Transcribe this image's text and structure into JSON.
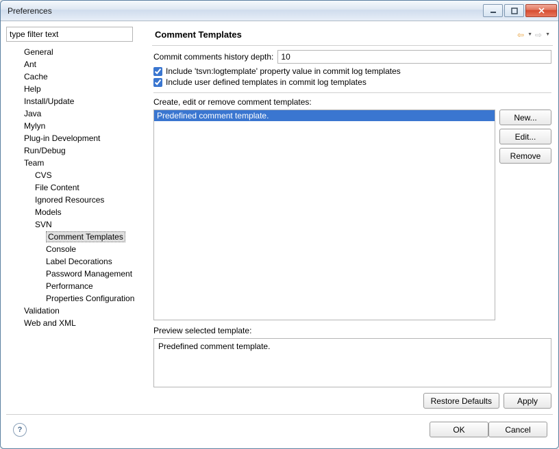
{
  "window": {
    "title": "Preferences"
  },
  "filter": {
    "value": "type filter text"
  },
  "tree": [
    {
      "label": "General",
      "indent": 1
    },
    {
      "label": "Ant",
      "indent": 1
    },
    {
      "label": "Cache",
      "indent": 1
    },
    {
      "label": "Help",
      "indent": 1
    },
    {
      "label": "Install/Update",
      "indent": 1
    },
    {
      "label": "Java",
      "indent": 1
    },
    {
      "label": "Mylyn",
      "indent": 1
    },
    {
      "label": "Plug-in Development",
      "indent": 1
    },
    {
      "label": "Run/Debug",
      "indent": 1
    },
    {
      "label": "Team",
      "indent": 1
    },
    {
      "label": "CVS",
      "indent": 2
    },
    {
      "label": "File Content",
      "indent": 2
    },
    {
      "label": "Ignored Resources",
      "indent": 2
    },
    {
      "label": "Models",
      "indent": 2
    },
    {
      "label": "SVN",
      "indent": 2
    },
    {
      "label": "Comment Templates",
      "indent": 3,
      "selected": true
    },
    {
      "label": "Console",
      "indent": 3
    },
    {
      "label": "Label Decorations",
      "indent": 3
    },
    {
      "label": "Password Management",
      "indent": 3
    },
    {
      "label": "Performance",
      "indent": 3
    },
    {
      "label": "Properties Configuration",
      "indent": 3
    },
    {
      "label": "Validation",
      "indent": 1
    },
    {
      "label": "Web and XML",
      "indent": 1
    }
  ],
  "page": {
    "title": "Comment Templates",
    "history_label": "Commit comments history depth:",
    "history_value": "10",
    "chk_tsvn": "Include 'tsvn:logtemplate' property value in commit log templates",
    "chk_user": "Include user defined templates in commit log templates",
    "templates_label": "Create, edit or remove comment templates:",
    "templates": [
      {
        "text": "Predefined comment template.",
        "selected": true
      }
    ],
    "btn_new": "New...",
    "btn_edit": "Edit...",
    "btn_remove": "Remove",
    "preview_label": "Preview selected template:",
    "preview_text": "Predefined comment template.",
    "btn_restore": "Restore Defaults",
    "btn_apply": "Apply"
  },
  "footer": {
    "ok": "OK",
    "cancel": "Cancel"
  }
}
